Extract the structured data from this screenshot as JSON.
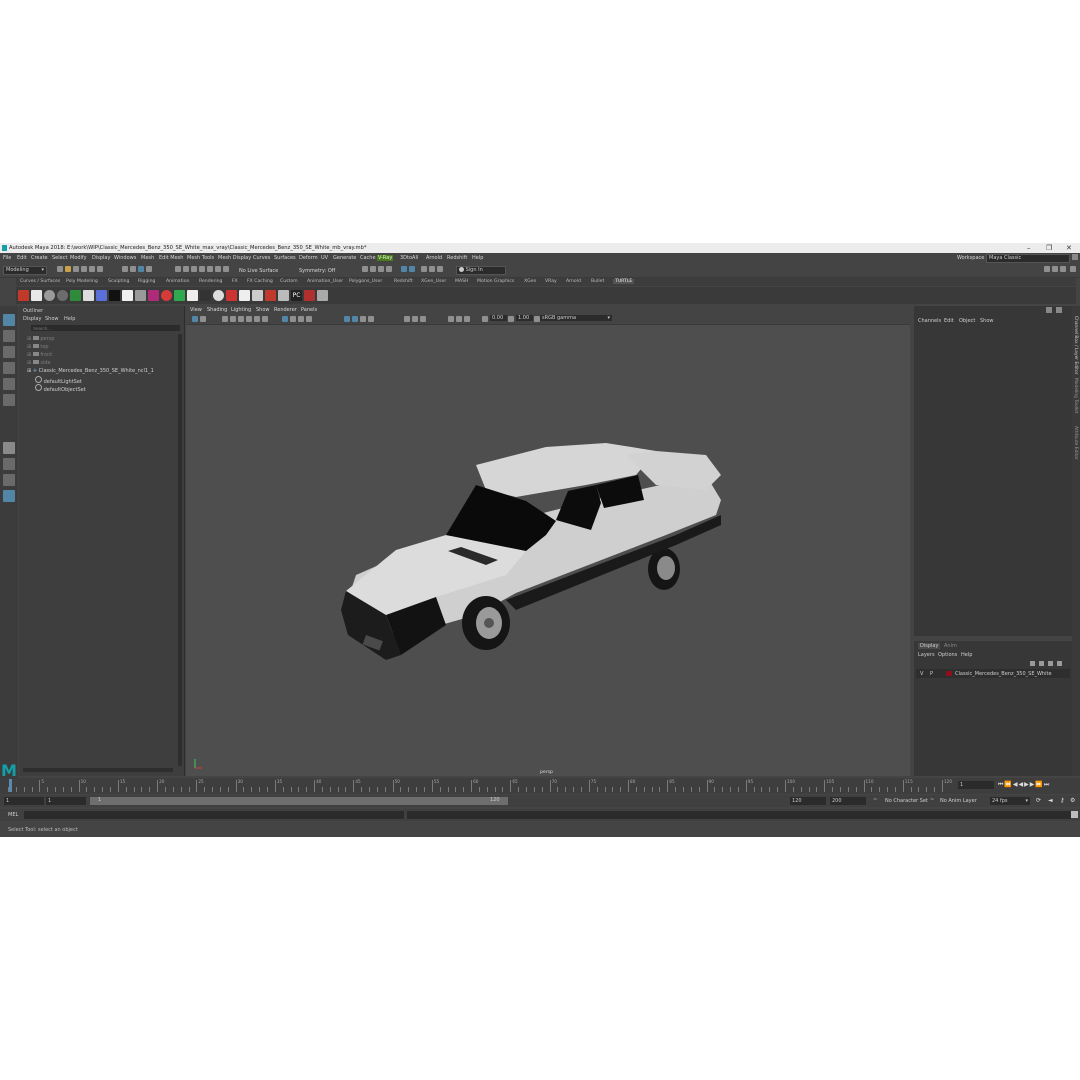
{
  "window": {
    "title": "Autodesk Maya 2018: E:\\work\\WIP\\Classic_Mercedes_Benz_350_SE_White_max_vray\\Classic_Mercedes_Benz_350_SE_White_mb_vray.mb*",
    "min": "–",
    "max": "❐",
    "close": "✕"
  },
  "menubar": {
    "items": [
      "File",
      "Edit",
      "Create",
      "Select",
      "Modify",
      "Display",
      "Windows",
      "Mesh",
      "Edit Mesh",
      "Mesh Tools",
      "Mesh Display",
      "Curves",
      "Surfaces",
      "Deform",
      "UV",
      "Generate",
      "Cache",
      "V-Ray",
      "3DtoAll",
      "Arnold",
      "Redshift",
      "Help"
    ],
    "workspace_label": "Workspace :",
    "workspace_value": "Maya Classic"
  },
  "statusline": {
    "mode": "Modeling",
    "live_surface": "No Live Surface",
    "symmetry": "Symmetry: Off",
    "sign_in": "Sign In"
  },
  "shelf": {
    "tabs": [
      "Curves / Surfaces",
      "Poly Modeling",
      "Sculpting",
      "Rigging",
      "Animation",
      "Rendering",
      "FX",
      "FX Caching",
      "Custom",
      "Animation_User",
      "Polygons_User",
      "Redshift",
      "XGen_User",
      "MASH",
      "Motion Graphics",
      "XGen",
      "VRay",
      "Arnold",
      "Bullet",
      "TURTLE"
    ],
    "active_tab": "TURTLE"
  },
  "outliner": {
    "title": "Outliner",
    "menu": [
      "Display",
      "Show",
      "Help"
    ],
    "search_placeholder": "Search...",
    "items": [
      "persp",
      "top",
      "front",
      "side",
      "Classic_Mercedes_Benz_350_SE_White_ncl1_1",
      "defaultLightSet",
      "defaultObjectSet"
    ]
  },
  "viewport": {
    "menu": [
      "View",
      "Shading",
      "Lighting",
      "Show",
      "Renderer",
      "Panels"
    ],
    "near_value": "0.00",
    "far_value": "1.00",
    "color_space": "sRGB gamma",
    "camera_label": "persp"
  },
  "channelbox": {
    "menu": [
      "Channels",
      "Edit",
      "Object",
      "Show"
    ]
  },
  "layers": {
    "tabs": [
      "Display",
      "Anim"
    ],
    "menu": [
      "Layers",
      "Options",
      "Help"
    ],
    "layer_vis": "V",
    "layer_playback": "P",
    "layer_name": "Classic_Mercedes_Benz_350_SE_White",
    "layer_color": "#8a1020"
  },
  "sidetabs": [
    "Channel Box / Layer Editor",
    "Modeling Toolkit",
    "Attribute Editor"
  ],
  "timeline": {
    "ticks": [
      "5",
      "10",
      "15",
      "20",
      "25",
      "30",
      "35",
      "40",
      "45",
      "50",
      "55",
      "60",
      "65",
      "70",
      "75",
      "80",
      "85",
      "90",
      "95",
      "100",
      "105",
      "110",
      "115",
      "120"
    ],
    "current_frame": "1"
  },
  "range": {
    "start": "1",
    "playback_start": "1",
    "slider_start": "1",
    "slider_end": "120",
    "playback_end": "120",
    "end": "200",
    "character_set": "No Character Set",
    "anim_layer": "No Anim Layer",
    "fps": "24 fps"
  },
  "cmdline": {
    "language": "MEL"
  },
  "helpline": {
    "text": "Select Tool: select an object"
  },
  "colors": {
    "ui_bg": "#444444",
    "panel_bg": "#373737",
    "accent": "#5285a6",
    "maya_logo": "#15a0a8"
  }
}
